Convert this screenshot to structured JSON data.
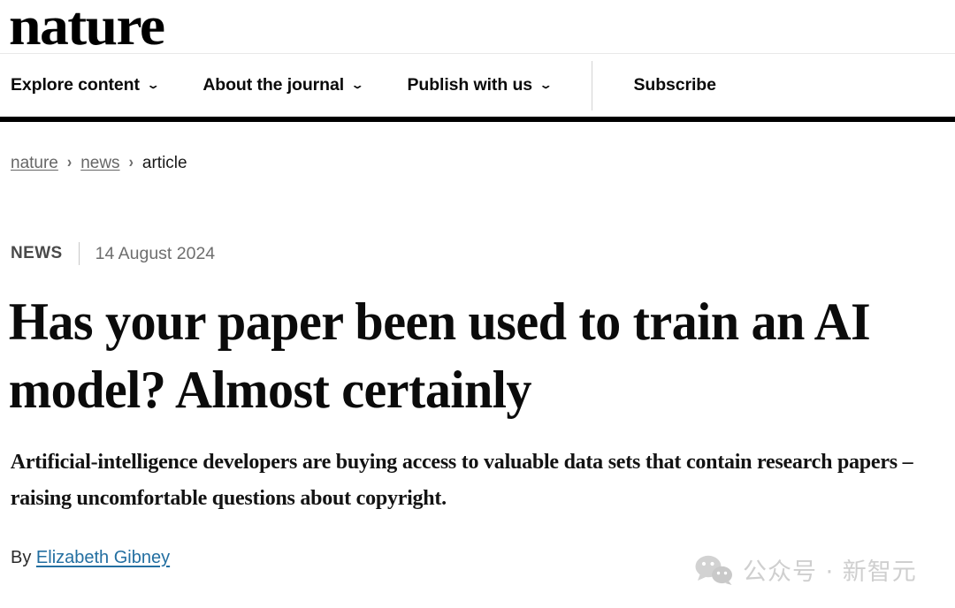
{
  "masthead": {
    "logo_text": "nature"
  },
  "nav": {
    "items": [
      {
        "label": "Explore content",
        "has_caret": true,
        "caret": "⌄"
      },
      {
        "label": "About the journal",
        "has_caret": true,
        "caret": "⌄"
      },
      {
        "label": "Publish with us",
        "has_caret": true,
        "caret": "⌄"
      }
    ],
    "subscribe_label": "Subscribe"
  },
  "breadcrumb": {
    "items": [
      {
        "label": "nature",
        "is_link": true
      },
      {
        "label": "news",
        "is_link": true
      },
      {
        "label": "article",
        "is_link": false
      }
    ],
    "separator": "›"
  },
  "article": {
    "kicker": "NEWS",
    "date": "14 August 2024",
    "headline": "Has your paper been used to train an AI model? Almost certainly",
    "standfirst": "Artificial-intelligence developers are buying access to valuable data sets that contain research papers – raising uncomfortable questions about copyright.",
    "byline_prefix": "By",
    "byline_author": "Elizabeth Gibney"
  },
  "watermark": {
    "icon_name": "wechat-logo-icon",
    "text": "公众号 · 新智元"
  },
  "colors": {
    "accent_link": "#236fa1",
    "rule_black": "#000000",
    "muted_text": "#6e6e6e",
    "watermark_gray": "#cfcfcf"
  }
}
